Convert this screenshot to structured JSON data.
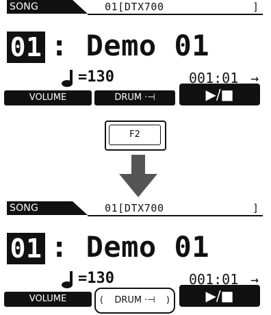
{
  "screens": [
    {
      "id": "before",
      "mode_tab": "SONG",
      "song_file": "01[DTX700",
      "bracket_close": "]",
      "song_number": "01",
      "song_name": ": Demo 01",
      "tempo": "=130",
      "position": "001:01",
      "arrow": "→",
      "buttons": {
        "volume": "VOLUME",
        "drum": "DRUM ·⊣",
        "play": "▶/■"
      }
    },
    {
      "id": "after",
      "mode_tab": "SONG",
      "song_file": "01[DTX700",
      "bracket_close": "]",
      "song_number": "01",
      "song_name": ": Demo 01",
      "tempo": "=130",
      "position": "001:01",
      "arrow": "→",
      "buttons": {
        "volume": "VOLUME",
        "drum": "DRUM ·⊣",
        "play": "▶/■"
      }
    }
  ],
  "f2_key_label": "F2",
  "icons": {
    "note": "quarter-note-icon",
    "transition_arrow": "down-arrow-icon"
  },
  "colors": {
    "lcd_ink": "#111111",
    "lcd_bg": "#ffffff",
    "arrow_gray": "#555555"
  }
}
